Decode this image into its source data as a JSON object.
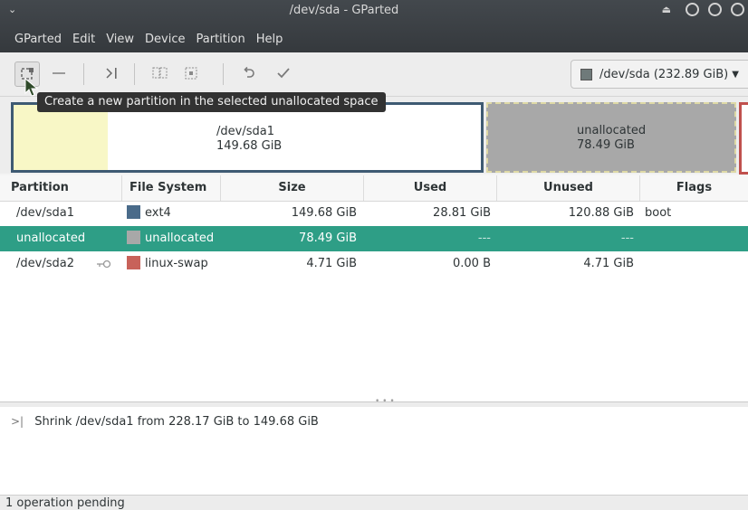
{
  "window": {
    "title": "/dev/sda - GParted",
    "menu_glyph": "⌄"
  },
  "menubar": [
    "GParted",
    "Edit",
    "View",
    "Device",
    "Partition",
    "Help"
  ],
  "toolbar": {
    "buttons": [
      "new-partition",
      "delete",
      "resize-move",
      "copy",
      "paste",
      "undo",
      "apply"
    ],
    "device_selector": "/dev/sda  (232.89 GiB)"
  },
  "tooltip": "Create a new partition in the selected unallocated space",
  "diskmap": {
    "sda1": {
      "name": "/dev/sda1",
      "size": "149.68 GiB"
    },
    "unallocated": {
      "name": "unallocated",
      "size": "78.49 GiB"
    }
  },
  "table": {
    "headers": [
      "Partition",
      "File System",
      "Size",
      "Used",
      "Unused",
      "Flags"
    ],
    "rows": [
      {
        "partition": "/dev/sda1",
        "fs": "ext4",
        "fs_color": "#4a6b8a",
        "size": "149.68 GiB",
        "used": "28.81 GiB",
        "unused": "120.88 GiB",
        "flags": "boot"
      },
      {
        "partition": "unallocated",
        "fs": "unallocated",
        "fs_color": "#a8a8a8",
        "size": "78.49 GiB",
        "used": "---",
        "unused": "---",
        "flags": ""
      },
      {
        "partition": "/dev/sda2",
        "fs": "linux-swap",
        "fs_color": "#c8625a",
        "size": "4.71 GiB",
        "used": "0.00 B",
        "unused": "4.71 GiB",
        "flags": ""
      }
    ]
  },
  "operations": [
    {
      "icon": ">|",
      "text": "Shrink /dev/sda1 from 228.17 GiB to 149.68 GiB"
    }
  ],
  "status": "1 operation pending"
}
